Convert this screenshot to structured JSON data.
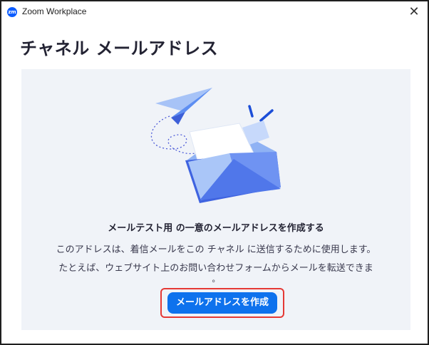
{
  "window": {
    "app_title": "Zoom Workplace",
    "logo_text": "zm",
    "close_symbol": "✕"
  },
  "page": {
    "title": "チャネル メールアドレス"
  },
  "content": {
    "heading": "メールテスト用 の一意のメールアドレスを作成する",
    "description_line1": "このアドレスは、着信メールをこの チャネル に送信するために使用します。",
    "description_line2": "たとえば、ウェブサイト上のお問い合わせフォームからメールを転送できま",
    "description_line3": "。",
    "create_button_label": "メールアドレスを作成"
  },
  "colors": {
    "accent": "#0e72ed",
    "highlight": "#e53935",
    "panel": "#f0f3f8"
  },
  "icons": {
    "illustration": "paper-plane-envelope-icon",
    "close": "close-icon",
    "logo": "zoom-logo-icon"
  }
}
